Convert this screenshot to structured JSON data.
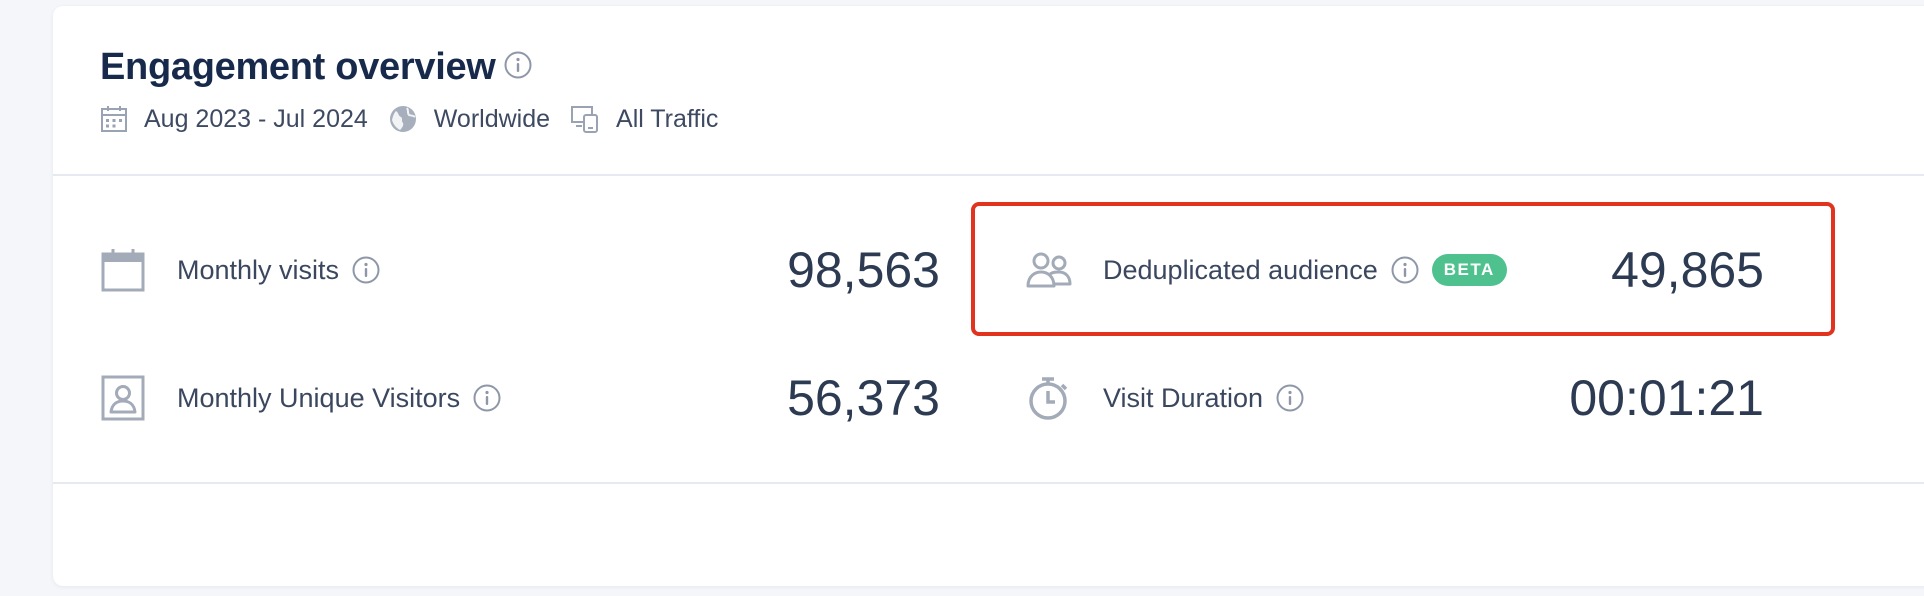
{
  "header": {
    "title": "Engagement overview",
    "date_range": "Aug 2023 - Jul 2024",
    "region": "Worldwide",
    "traffic": "All Traffic"
  },
  "metrics": {
    "monthly_visits": {
      "label": "Monthly visits",
      "value": "98,563",
      "icon": "calendar-icon"
    },
    "deduplicated_audience": {
      "label": "Deduplicated audience",
      "badge": "BETA",
      "value": "49,865",
      "icon": "users-icon"
    },
    "monthly_unique_visitors": {
      "label": "Monthly Unique Visitors",
      "value": "56,373",
      "icon": "visitor-card-icon"
    },
    "visit_duration": {
      "label": "Visit Duration",
      "value": "00:01:21",
      "icon": "stopwatch-icon"
    }
  },
  "colors": {
    "highlight": "#e1331d",
    "beta_badge": "#4fc18f",
    "title": "#182a4b"
  }
}
